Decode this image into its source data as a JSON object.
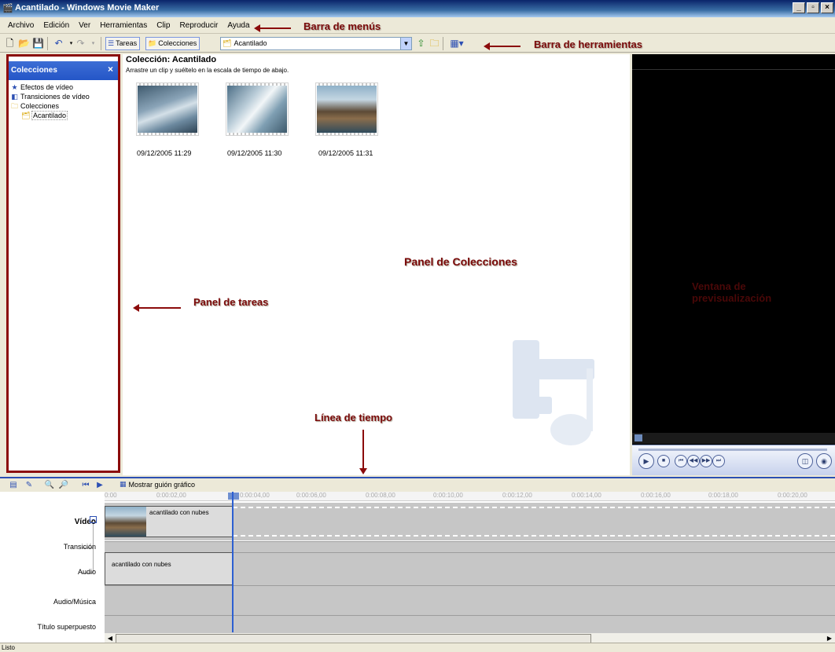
{
  "window": {
    "title": "Acantilado - Windows Movie Maker",
    "btn_min": "_",
    "btn_max": "▫",
    "btn_close": "×"
  },
  "menubar": {
    "items": [
      "Archivo",
      "Edición",
      "Ver",
      "Herramientas",
      "Clip",
      "Reproducir",
      "Ayuda"
    ]
  },
  "toolbar": {
    "tasks_label": "Tareas",
    "collections_label": "Colecciones",
    "collection_combo_value": "Acantilado"
  },
  "annotations": {
    "menubar": "Barra de menús",
    "toolbar": "Barra de herramientas",
    "collections_panel": "Panel de Colecciones",
    "tasks_panel": "Panel de tareas",
    "timeline": "Línea de tiempo",
    "preview_line1": "Ventana de",
    "preview_line2": "previsualización"
  },
  "tasks_pane": {
    "title": "Colecciones",
    "items": [
      "Efectos de vídeo",
      "Transiciones de vídeo",
      "Colecciones",
      "Acantilado"
    ]
  },
  "collection": {
    "title": "Colección: Acantilado",
    "hint": "Arrastre un clip y suéltelo en la escala de tiempo de abajo.",
    "clips": [
      {
        "date": "09/12/2005 11:29"
      },
      {
        "date": "09/12/2005 11:30"
      },
      {
        "date": "09/12/2005 11:31"
      }
    ]
  },
  "timeline": {
    "storyboard_label": "Mostrar guión gráfico",
    "ruler_ticks": [
      "0:00",
      "0:00:02,00",
      "0:00:04,00",
      "0:00:06,00",
      "0:00:08,00",
      "0:00:10,00",
      "0:00:12,00",
      "0:00:14,00",
      "0:00:16,00",
      "0:00:18,00",
      "0:00:20,00"
    ],
    "tracks": {
      "video": "Vídeo",
      "transition": "Transición",
      "audio": "Audio",
      "music": "Audio/Música",
      "title": "Título superpuesto"
    },
    "video_clip_name": "acantilado con nubes",
    "audio_clip_name": "acantilado con nubes"
  },
  "status": {
    "text": "Listo"
  }
}
